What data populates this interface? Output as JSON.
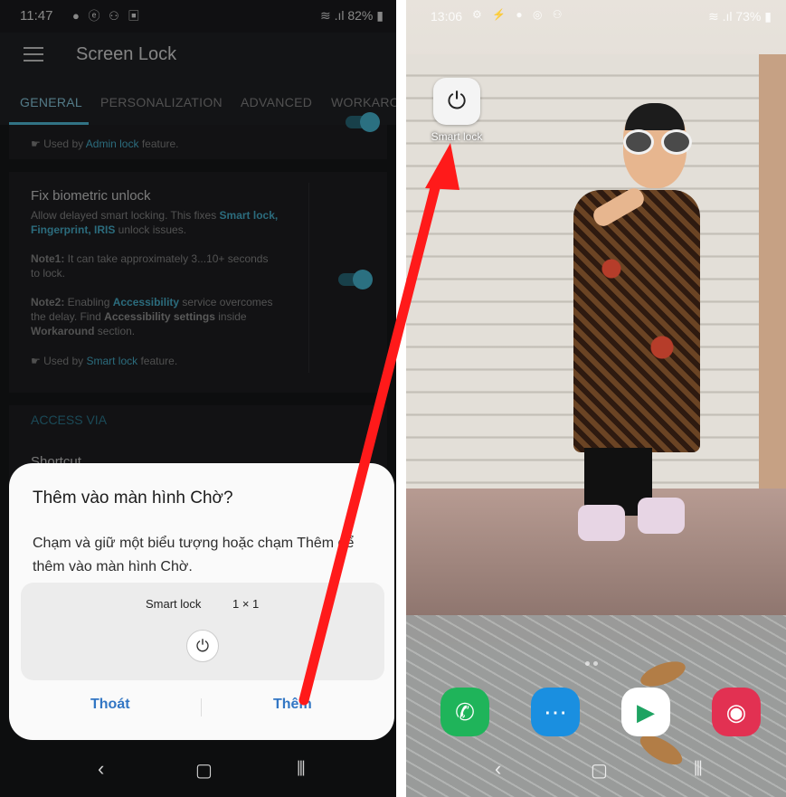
{
  "left": {
    "status": {
      "time": "11:47",
      "battery": "82%"
    },
    "app_title": "Screen Lock",
    "tabs": [
      "GENERAL",
      "PERSONALIZATION",
      "ADVANCED",
      "WORKARO"
    ],
    "used_admin": {
      "prefix": "Used by ",
      "feature": "Admin lock",
      "suffix": " feature."
    },
    "biometric": {
      "title": "Fix biometric unlock",
      "desc_a": "Allow delayed smart locking. This fixes ",
      "desc_b": "Smart lock, Fingerprint, IRIS",
      "desc_c": " unlock issues.",
      "note1_label": "Note1:",
      "note1_text": " It can take approximately 3...10+ seconds to lock.",
      "note2_label": "Note2:",
      "note2_text_a": " Enabling ",
      "note2_acc": "Accessibility",
      "note2_text_b": " service overcomes the delay. Find ",
      "note2_acc2": "Accessibility settings",
      "note2_text_c": " inside ",
      "note2_work": "Workaround",
      "note2_text_d": " section."
    },
    "used_smart": {
      "prefix": "Used by ",
      "feature": "Smart lock",
      "suffix": " feature."
    },
    "section_access": "ACCESS VIA",
    "shortcut_label": "Shortcut",
    "sheet": {
      "title": "Thêm vào màn hình Chờ?",
      "desc": "Chạm và giữ một biểu tượng hoặc chạm Thêm để thêm vào màn hình Chờ.",
      "widget_name": "Smart lock",
      "widget_size": "1 × 1",
      "cancel": "Thoát",
      "add": "Thêm"
    }
  },
  "right": {
    "status": {
      "time": "13:06",
      "battery": "73%"
    },
    "widget_label": "Smart lock"
  },
  "colors": {
    "accent": "#4bb8d6",
    "button": "#3276c4",
    "arrow": "#ff1a1a"
  }
}
